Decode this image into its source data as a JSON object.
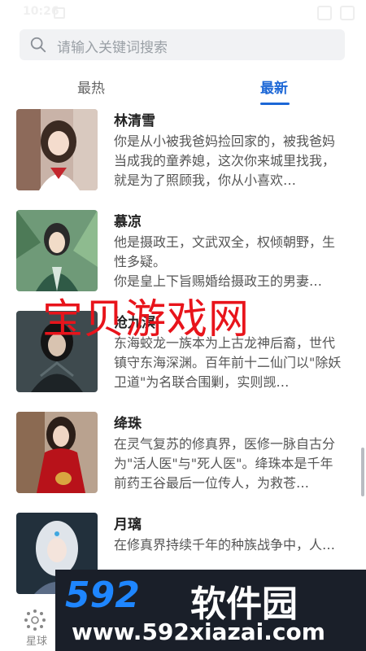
{
  "status_bar": {
    "time": "10:26"
  },
  "search": {
    "placeholder": "请输入关键词搜索"
  },
  "tabs": [
    {
      "label": "最热",
      "active": false
    },
    {
      "label": "最新",
      "active": true
    }
  ],
  "accent_color": "#1c67d6",
  "items": [
    {
      "name": "林清雪",
      "desc": "你是从小被我爸妈捡回家的，被我爸妈当成我的童养媳，这次你来城里找我，就是为了照顾我，你从小喜欢…"
    },
    {
      "name": "慕凉",
      "desc": "他是摄政王，文武双全，权倾朝野，生性多疑。\n你是皇上下旨赐婚给摄政王的男妻…"
    },
    {
      "name": "沧九溟",
      "desc": "东海蛟龙一族本为上古龙神后裔，世代镇守东海深渊。百年前十二仙门以\"除妖卫道\"为名联合围剿，实则觊…"
    },
    {
      "name": "绛珠",
      "desc": "在灵气复苏的修真界，医修一脉自古分为\"活人医\"与\"死人医\"。绛珠本是千年前药王谷最后一位传人，为救苍…"
    },
    {
      "name": "月璃",
      "desc": "在修真界持续千年的种族战争中，人…"
    }
  ],
  "watermark": {
    "red_text": "宝贝游戏网",
    "brand_top_a": "592",
    "brand_top_b": "软件园",
    "brand_url": "www.592xiazai.com"
  },
  "bottom_nav": {
    "planet_label": "星球"
  }
}
